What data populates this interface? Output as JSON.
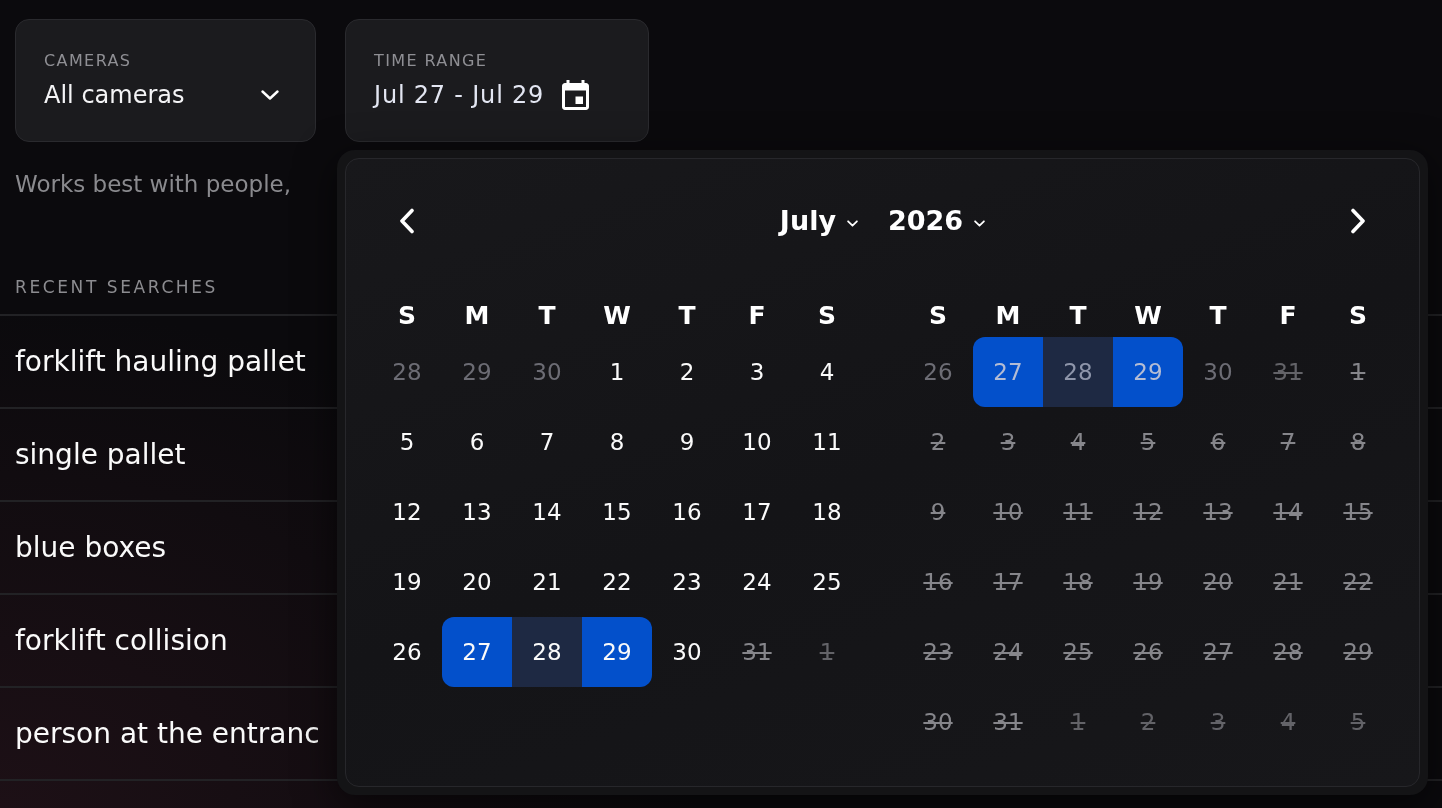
{
  "filters": [
    {
      "kind": "dropdown",
      "label": "CAMERAS",
      "value": "All cameras"
    },
    {
      "kind": "date",
      "label": "TIME RANGE",
      "value": "Jul 27 - Jul 29"
    }
  ],
  "hint": "Works best with people,",
  "recent_searches": {
    "title": "RECENT SEARCHES",
    "items": [
      "forklift hauling pallet",
      "single pallet",
      "blue boxes",
      "forklift collision",
      "person at the entranc"
    ]
  },
  "date_picker": {
    "month": "July",
    "year": "2026",
    "months": [
      {
        "weekdays": [
          "S",
          "M",
          "T",
          "W",
          "T",
          "F",
          "S"
        ],
        "weeks": [
          [
            {
              "day": "28",
              "outside": true,
              "disabled": false,
              "selected": false,
              "in_range": false
            },
            {
              "day": "29",
              "outside": true,
              "disabled": false,
              "selected": false,
              "in_range": false
            },
            {
              "day": "30",
              "outside": true,
              "disabled": false,
              "selected": false,
              "in_range": false
            },
            {
              "day": "1",
              "outside": false,
              "disabled": false,
              "selected": false,
              "in_range": false
            },
            {
              "day": "2",
              "outside": false,
              "disabled": false,
              "selected": false,
              "in_range": false
            },
            {
              "day": "3",
              "outside": false,
              "disabled": false,
              "selected": false,
              "in_range": false
            },
            {
              "day": "4",
              "outside": false,
              "disabled": false,
              "selected": false,
              "in_range": false
            }
          ],
          [
            {
              "day": "5",
              "outside": false,
              "disabled": false,
              "selected": false,
              "in_range": false
            },
            {
              "day": "6",
              "outside": false,
              "disabled": false,
              "selected": false,
              "in_range": false
            },
            {
              "day": "7",
              "outside": false,
              "disabled": false,
              "selected": false,
              "in_range": false
            },
            {
              "day": "8",
              "outside": false,
              "disabled": false,
              "selected": false,
              "in_range": false
            },
            {
              "day": "9",
              "outside": false,
              "disabled": false,
              "selected": false,
              "in_range": false
            },
            {
              "day": "10",
              "outside": false,
              "disabled": false,
              "selected": false,
              "in_range": false
            },
            {
              "day": "11",
              "outside": false,
              "disabled": false,
              "selected": false,
              "in_range": false
            }
          ],
          [
            {
              "day": "12",
              "outside": false,
              "disabled": false,
              "selected": false,
              "in_range": false
            },
            {
              "day": "13",
              "outside": false,
              "disabled": false,
              "selected": false,
              "in_range": false
            },
            {
              "day": "14",
              "outside": false,
              "disabled": false,
              "selected": false,
              "in_range": false
            },
            {
              "day": "15",
              "outside": false,
              "disabled": false,
              "selected": false,
              "in_range": false
            },
            {
              "day": "16",
              "outside": false,
              "disabled": false,
              "selected": false,
              "in_range": false
            },
            {
              "day": "17",
              "outside": false,
              "disabled": false,
              "selected": false,
              "in_range": false
            },
            {
              "day": "18",
              "outside": false,
              "disabled": false,
              "selected": false,
              "in_range": false
            }
          ],
          [
            {
              "day": "19",
              "outside": false,
              "disabled": false,
              "selected": false,
              "in_range": false
            },
            {
              "day": "20",
              "outside": false,
              "disabled": false,
              "selected": false,
              "in_range": false
            },
            {
              "day": "21",
              "outside": false,
              "disabled": false,
              "selected": false,
              "in_range": false
            },
            {
              "day": "22",
              "outside": false,
              "disabled": false,
              "selected": false,
              "in_range": false
            },
            {
              "day": "23",
              "outside": false,
              "disabled": false,
              "selected": false,
              "in_range": false
            },
            {
              "day": "24",
              "outside": false,
              "disabled": false,
              "selected": false,
              "in_range": false
            },
            {
              "day": "25",
              "outside": false,
              "disabled": false,
              "selected": false,
              "in_range": false
            }
          ],
          [
            {
              "day": "26",
              "outside": false,
              "disabled": false,
              "selected": false,
              "in_range": false
            },
            {
              "day": "27",
              "outside": false,
              "disabled": false,
              "selected": true,
              "in_range": false
            },
            {
              "day": "28",
              "outside": false,
              "disabled": false,
              "selected": false,
              "in_range": true
            },
            {
              "day": "29",
              "outside": false,
              "disabled": false,
              "selected": true,
              "in_range": false
            },
            {
              "day": "30",
              "outside": false,
              "disabled": false,
              "selected": false,
              "in_range": false
            },
            {
              "day": "31",
              "outside": false,
              "disabled": true,
              "selected": false,
              "in_range": false
            },
            {
              "day": "1",
              "outside": true,
              "disabled": true,
              "selected": false,
              "in_range": false
            }
          ]
        ]
      },
      {
        "weekdays": [
          "S",
          "M",
          "T",
          "W",
          "T",
          "F",
          "S"
        ],
        "weeks": [
          [
            {
              "day": "26",
              "outside": true,
              "disabled": false,
              "selected": false,
              "in_range": false
            },
            {
              "day": "27",
              "outside": true,
              "disabled": false,
              "selected": true,
              "in_range": false
            },
            {
              "day": "28",
              "outside": true,
              "disabled": false,
              "selected": false,
              "in_range": true
            },
            {
              "day": "29",
              "outside": true,
              "disabled": false,
              "selected": true,
              "in_range": false
            },
            {
              "day": "30",
              "outside": true,
              "disabled": false,
              "selected": false,
              "in_range": false
            },
            {
              "day": "31",
              "outside": true,
              "disabled": true,
              "selected": false,
              "in_range": false
            },
            {
              "day": "1",
              "outside": false,
              "disabled": true,
              "selected": false,
              "in_range": false
            }
          ],
          [
            {
              "day": "2",
              "outside": false,
              "disabled": true,
              "selected": false,
              "in_range": false
            },
            {
              "day": "3",
              "outside": false,
              "disabled": true,
              "selected": false,
              "in_range": false
            },
            {
              "day": "4",
              "outside": false,
              "disabled": true,
              "selected": false,
              "in_range": false
            },
            {
              "day": "5",
              "outside": false,
              "disabled": true,
              "selected": false,
              "in_range": false
            },
            {
              "day": "6",
              "outside": false,
              "disabled": true,
              "selected": false,
              "in_range": false
            },
            {
              "day": "7",
              "outside": false,
              "disabled": true,
              "selected": false,
              "in_range": false
            },
            {
              "day": "8",
              "outside": false,
              "disabled": true,
              "selected": false,
              "in_range": false
            }
          ],
          [
            {
              "day": "9",
              "outside": false,
              "disabled": true,
              "selected": false,
              "in_range": false
            },
            {
              "day": "10",
              "outside": false,
              "disabled": true,
              "selected": false,
              "in_range": false
            },
            {
              "day": "11",
              "outside": false,
              "disabled": true,
              "selected": false,
              "in_range": false
            },
            {
              "day": "12",
              "outside": false,
              "disabled": true,
              "selected": false,
              "in_range": false
            },
            {
              "day": "13",
              "outside": false,
              "disabled": true,
              "selected": false,
              "in_range": false
            },
            {
              "day": "14",
              "outside": false,
              "disabled": true,
              "selected": false,
              "in_range": false
            },
            {
              "day": "15",
              "outside": false,
              "disabled": true,
              "selected": false,
              "in_range": false
            }
          ],
          [
            {
              "day": "16",
              "outside": false,
              "disabled": true,
              "selected": false,
              "in_range": false
            },
            {
              "day": "17",
              "outside": false,
              "disabled": true,
              "selected": false,
              "in_range": false
            },
            {
              "day": "18",
              "outside": false,
              "disabled": true,
              "selected": false,
              "in_range": false
            },
            {
              "day": "19",
              "outside": false,
              "disabled": true,
              "selected": false,
              "in_range": false
            },
            {
              "day": "20",
              "outside": false,
              "disabled": true,
              "selected": false,
              "in_range": false
            },
            {
              "day": "21",
              "outside": false,
              "disabled": true,
              "selected": false,
              "in_range": false
            },
            {
              "day": "22",
              "outside": false,
              "disabled": true,
              "selected": false,
              "in_range": false
            }
          ],
          [
            {
              "day": "23",
              "outside": false,
              "disabled": true,
              "selected": false,
              "in_range": false
            },
            {
              "day": "24",
              "outside": false,
              "disabled": true,
              "selected": false,
              "in_range": false
            },
            {
              "day": "25",
              "outside": false,
              "disabled": true,
              "selected": false,
              "in_range": false
            },
            {
              "day": "26",
              "outside": false,
              "disabled": true,
              "selected": false,
              "in_range": false
            },
            {
              "day": "27",
              "outside": false,
              "disabled": true,
              "selected": false,
              "in_range": false
            },
            {
              "day": "28",
              "outside": false,
              "disabled": true,
              "selected": false,
              "in_range": false
            },
            {
              "day": "29",
              "outside": false,
              "disabled": true,
              "selected": false,
              "in_range": false
            }
          ],
          [
            {
              "day": "30",
              "outside": false,
              "disabled": true,
              "selected": false,
              "in_range": false
            },
            {
              "day": "31",
              "outside": false,
              "disabled": true,
              "selected": false,
              "in_range": false
            },
            {
              "day": "1",
              "outside": true,
              "disabled": true,
              "selected": false,
              "in_range": false
            },
            {
              "day": "2",
              "outside": true,
              "disabled": true,
              "selected": false,
              "in_range": false
            },
            {
              "day": "3",
              "outside": true,
              "disabled": true,
              "selected": false,
              "in_range": false
            },
            {
              "day": "4",
              "outside": true,
              "disabled": true,
              "selected": false,
              "in_range": false
            },
            {
              "day": "5",
              "outside": true,
              "disabled": true,
              "selected": false,
              "in_range": false
            }
          ]
        ]
      }
    ]
  }
}
